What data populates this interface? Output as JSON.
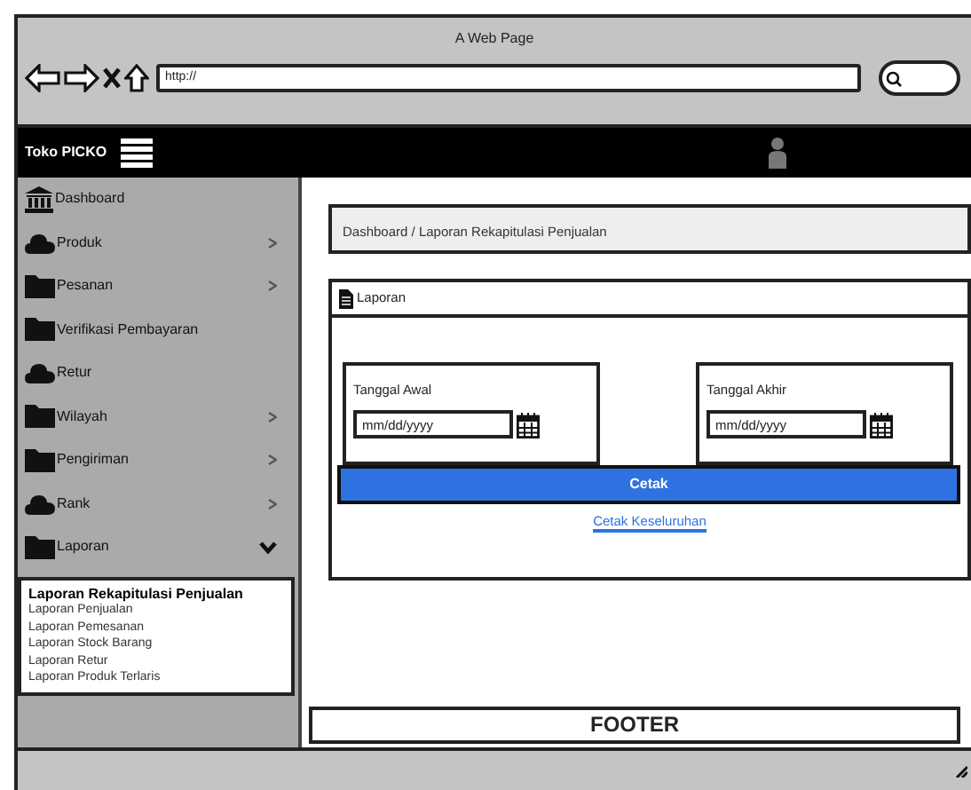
{
  "window": {
    "title": "A Web Page",
    "url": "http://"
  },
  "navbar": {
    "brand": "Toko PICKO"
  },
  "sidebar": {
    "items": [
      {
        "label": "Dashboard"
      },
      {
        "label": "Produk",
        "expanded": false
      },
      {
        "label": "Pesanan",
        "expanded": false
      },
      {
        "label": "Verifikasi Pembayaran"
      },
      {
        "label": "Retur"
      },
      {
        "label": "Wilayah",
        "expanded": false
      },
      {
        "label": "Pengiriman",
        "expanded": false
      },
      {
        "label": "Rank",
        "expanded": false
      },
      {
        "label": "Laporan",
        "expanded": true,
        "children": [
          {
            "label": "Laporan Rekapitulasi Penjualan",
            "selected": true
          },
          {
            "label": "Laporan Penjualan",
            "selected": false
          },
          {
            "label": "Laporan Pemesanan",
            "selected": false
          },
          {
            "label": "Laporan Stock Barang",
            "selected": false
          },
          {
            "label": "Laporan Retur",
            "selected": false
          },
          {
            "label": "Laporan Produk Terlaris",
            "selected": false
          }
        ]
      }
    ]
  },
  "breadcrumb": "Dashboard / Laporan Rekapitulasi Penjualan",
  "card": {
    "title": "Laporan",
    "fields": [
      {
        "label": "Tanggal Awal",
        "placeholder": "mm/dd/yyyy"
      },
      {
        "label": "Tanggal Akhir",
        "placeholder": "mm/dd/yyyy"
      }
    ],
    "print_button": "Cetak",
    "link": "Cetak Keseluruhan"
  },
  "footer": "FOOTER"
}
